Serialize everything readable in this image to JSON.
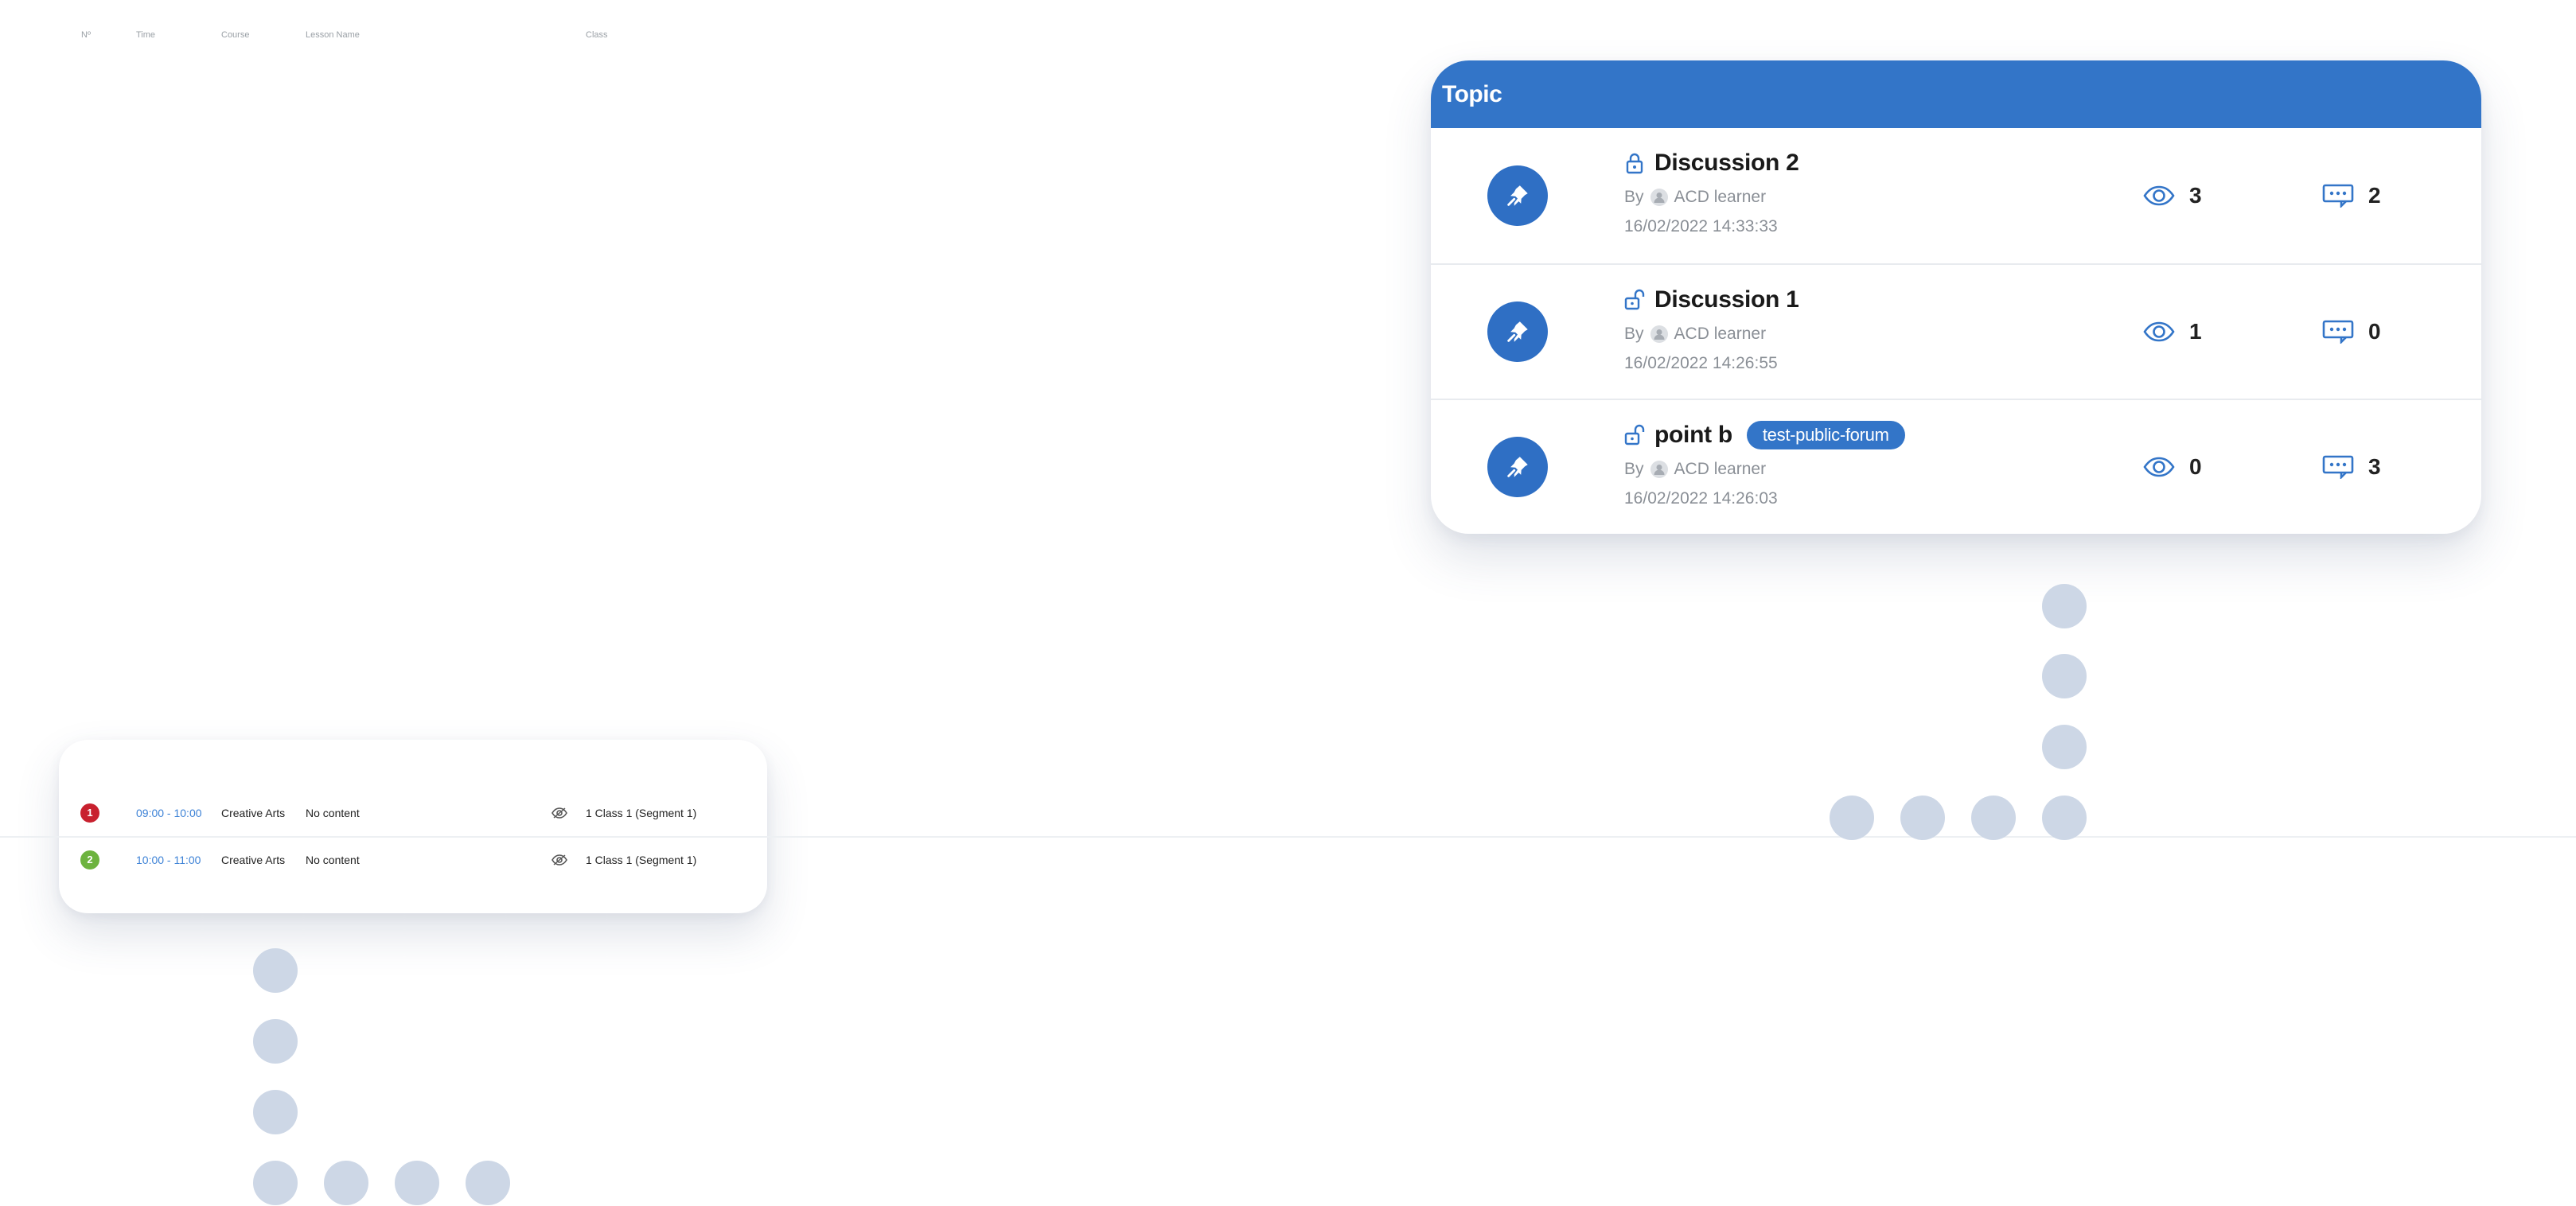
{
  "forum": {
    "header": "Topic",
    "topics": [
      {
        "title": "Discussion 2",
        "badge": "",
        "by_label": "By",
        "author": "ACD learner",
        "date": "16/02/2022 14:33:33",
        "views": "3",
        "replies": "2",
        "lock": "locked"
      },
      {
        "title": "Discussion 1",
        "badge": "",
        "by_label": "By",
        "author": "ACD learner",
        "date": "16/02/2022 14:26:55",
        "views": "1",
        "replies": "0",
        "lock": "unlocked"
      },
      {
        "title": "point b",
        "badge": "test-public-forum",
        "by_label": "By",
        "author": "ACD learner",
        "date": "16/02/2022 14:26:03",
        "views": "0",
        "replies": "3",
        "lock": "unlocked"
      }
    ]
  },
  "schedule": {
    "headers": {
      "no": "Nº",
      "time": "Time",
      "course": "Course",
      "lesson": "Lesson Name",
      "class": "Class"
    },
    "rows": [
      {
        "no": "1",
        "time": "09:00 - 10:00",
        "course": "Creative Arts",
        "lesson": "No content",
        "class": "1 Class 1 (Segment 1)",
        "badge_color": "#c8202e"
      },
      {
        "no": "2",
        "time": "10:00 - 11:00",
        "course": "Creative Arts",
        "lesson": "No content",
        "class": "1 Class 1 (Segment 1)",
        "badge_color": "#6db33f"
      }
    ]
  },
  "colors": {
    "accent": "#3375c8",
    "dot": "#cdd7e6",
    "muted_text": "#8a8f96"
  },
  "icons": {
    "pin": "pin-icon",
    "locked": "lock-closed-icon",
    "unlocked": "lock-open-icon",
    "views": "eye-icon",
    "replies": "chat-icon",
    "author": "user-avatar-icon"
  }
}
